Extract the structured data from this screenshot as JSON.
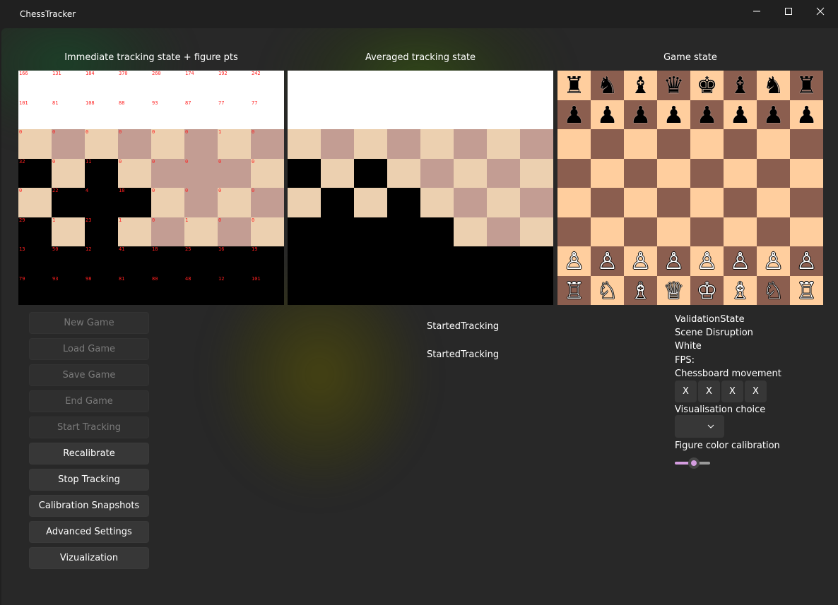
{
  "window": {
    "title": "ChessTracker",
    "controls": [
      {
        "name": "minimize-icon",
        "glyph": "—"
      },
      {
        "name": "maximize-icon",
        "glyph": "□"
      },
      {
        "name": "close-icon",
        "glyph": "✕"
      }
    ]
  },
  "colors": {
    "light_square": "#ecd0b0",
    "dark_square": "#c39d93",
    "game_light": "#ffce9e",
    "game_dark": "#8b5e4f",
    "number_text": "#ff2020",
    "accent": "#d49de0"
  },
  "panels": {
    "immediate": {
      "title": "Immediate tracking state + figure pts",
      "rows": [
        {
          "fill": "white",
          "cells": [
            "166",
            "131",
            "184",
            "370",
            "260",
            "174",
            "192",
            "242"
          ]
        },
        {
          "fill": "white",
          "cells": [
            "101",
            "81",
            "108",
            "88",
            "93",
            "87",
            "77",
            "77"
          ]
        },
        {
          "fill": "LDLDLDLD",
          "cells": [
            "0",
            "0",
            "0",
            "0",
            "0",
            "0",
            "1",
            "0"
          ]
        },
        {
          "fill": "BLBLDDDL",
          "cells": [
            "32",
            "0",
            "11",
            "0",
            "0",
            "0",
            "0",
            "0"
          ]
        },
        {
          "fill": "LBBBLDLD",
          "cells": [
            "0",
            "22",
            "4",
            "18",
            "0",
            "0",
            "0",
            "0"
          ]
        },
        {
          "fill": "BLBLDLDL",
          "cells": [
            "29",
            "1",
            "23",
            "1",
            "0",
            "1",
            "0",
            "0"
          ]
        },
        {
          "fill": "black",
          "cells": [
            "13",
            "50",
            "12",
            "41",
            "18",
            "25",
            "16",
            "19"
          ]
        },
        {
          "fill": "black",
          "cells": [
            "79",
            "93",
            "98",
            "81",
            "80",
            "48",
            "12",
            "101"
          ]
        }
      ]
    },
    "averaged": {
      "title": "Averaged tracking state",
      "rows": [
        "white",
        "white",
        "LDLDLDLD",
        "BLBLDLDL",
        "LBLBLDLD",
        "BBBBBLDL",
        "black",
        "black"
      ]
    },
    "game": {
      "title": "Game state",
      "rows": [
        [
          "♜",
          "♞",
          "♝",
          "♛",
          "♚",
          "♝",
          "♞",
          "♜"
        ],
        [
          "♟",
          "♟",
          "♟",
          "♟",
          "♟",
          "♟",
          "♟",
          "♟"
        ],
        [
          "",
          "",
          "",
          "",
          "",
          "",
          "",
          ""
        ],
        [
          "",
          "",
          "",
          "",
          "",
          "",
          "",
          ""
        ],
        [
          "",
          "",
          "",
          "",
          "",
          "",
          "",
          ""
        ],
        [
          "",
          "",
          "",
          "",
          "",
          "",
          "",
          ""
        ],
        [
          "♙",
          "♙",
          "♙",
          "♙",
          "♙",
          "♙",
          "♙",
          "♙"
        ],
        [
          "♖",
          "♘",
          "♗",
          "♕",
          "♔",
          "♗",
          "♘",
          "♖"
        ]
      ]
    }
  },
  "buttons": [
    {
      "label": "New Game",
      "name": "new-game-button",
      "enabled": false
    },
    {
      "label": "Load Game",
      "name": "load-game-button",
      "enabled": false
    },
    {
      "label": "Save Game",
      "name": "save-game-button",
      "enabled": false
    },
    {
      "label": "End Game",
      "name": "end-game-button",
      "enabled": false
    },
    {
      "label": "Start Tracking",
      "name": "start-tracking-button",
      "enabled": false
    },
    {
      "label": "Recalibrate",
      "name": "recalibrate-button",
      "enabled": true
    },
    {
      "label": "Stop Tracking",
      "name": "stop-tracking-button",
      "enabled": true
    },
    {
      "label": "Calibration Snapshots",
      "name": "calibration-snapshots-button",
      "enabled": true
    },
    {
      "label": "Advanced Settings",
      "name": "advanced-settings-button",
      "enabled": true
    },
    {
      "label": "Vizualization",
      "name": "vizualization-button",
      "enabled": true
    }
  ],
  "status": {
    "line1": "StartedTracking",
    "line2": "StartedTracking"
  },
  "side": {
    "validation_state": "ValidationState",
    "scene_disruption": "Scene Disruption",
    "color": "White",
    "fps": "FPS:",
    "chessboard_movement_label": "Chessboard movement",
    "movement_buttons": [
      "X",
      "X",
      "X",
      "X"
    ],
    "visualisation_label": "Visualisation choice",
    "visualisation_value": "",
    "figure_calibration_label": "Figure color calibration",
    "figure_calibration_value": 0.5
  }
}
